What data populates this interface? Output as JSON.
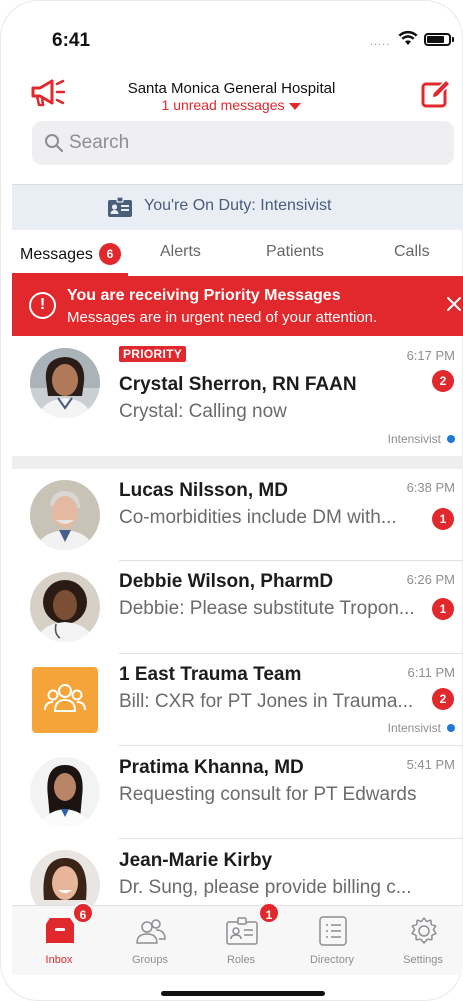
{
  "status": {
    "time": "6:41",
    "signal": "....."
  },
  "header": {
    "title": "Santa Monica General Hospital",
    "subtitle": "1 unread messages",
    "megaphone_icon": "megaphone-icon",
    "compose_icon": "compose-icon",
    "accent": "#e1282c"
  },
  "search": {
    "placeholder": "Search"
  },
  "duty": {
    "text": "You're On Duty: Intensivist"
  },
  "tabs": {
    "messages": {
      "label": "Messages",
      "count": "6"
    },
    "alerts": {
      "label": "Alerts"
    },
    "patients": {
      "label": "Patients"
    },
    "calls": {
      "label": "Calls"
    }
  },
  "banner": {
    "title": "You are receiving Priority Messages",
    "body": "Messages are in urgent need of your attention."
  },
  "conversations": [
    {
      "tag": "PRIORITY",
      "name": "Crystal Sherron, RN FAAN",
      "preview": "Crystal: Calling now",
      "time": "6:17 PM",
      "count": "2",
      "role": "Intensivist"
    },
    {
      "name": "Lucas Nilsson, MD",
      "preview": "Co-morbidities include DM with...",
      "time": "6:38 PM",
      "count": "1"
    },
    {
      "name": "Debbie Wilson, PharmD",
      "preview": "Debbie: Please substitute Tropon...",
      "time": "6:26 PM",
      "count": "1"
    },
    {
      "name": "1 East Trauma Team",
      "preview": "Bill: CXR for PT Jones in Trauma...",
      "time": "6:11 PM",
      "count": "2",
      "role": "Intensivist"
    },
    {
      "name": "Pratima Khanna, MD",
      "preview": "Requesting consult for PT Edwards",
      "time": "5:41 PM"
    },
    {
      "name": "Jean-Marie Kirby",
      "preview": "Dr. Sung, please provide billing c..."
    }
  ],
  "tabbar": {
    "inbox": {
      "label": "Inbox",
      "count": "6"
    },
    "groups": {
      "label": "Groups"
    },
    "roles": {
      "label": "Roles",
      "count": "1"
    },
    "directory": {
      "label": "Directory"
    },
    "settings": {
      "label": "Settings"
    }
  }
}
